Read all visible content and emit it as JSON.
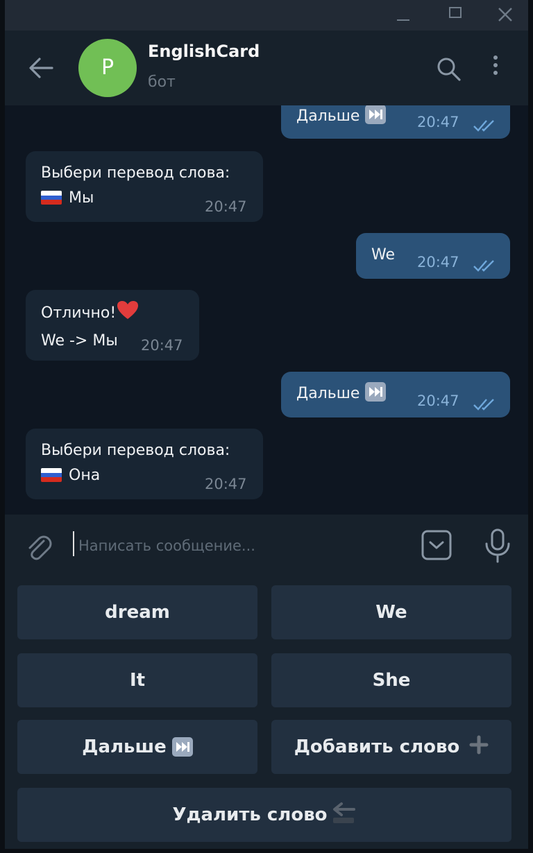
{
  "window": {
    "controls": [
      "minimize-icon",
      "maximize-icon",
      "close-icon"
    ]
  },
  "header": {
    "avatar_letter": "P",
    "avatar_color": "#71bf55",
    "title": "EnglishCard",
    "subtitle": "бот"
  },
  "messages": [
    {
      "dir": "out",
      "text": "Дальше",
      "icon": "fast-forward-icon",
      "time": "20:47",
      "status": "read"
    },
    {
      "dir": "in",
      "line1": "Выбери перевод слова:",
      "line2": "Мы",
      "flag": "russia-flag-icon",
      "time": "20:47"
    },
    {
      "dir": "out",
      "text": "We",
      "time": "20:47",
      "status": "read"
    },
    {
      "dir": "in",
      "line1": "Отлично!",
      "line2": "We -> Мы",
      "icon": "heart-icon",
      "time": "20:47"
    },
    {
      "dir": "out",
      "text": "Дальше",
      "icon": "fast-forward-icon",
      "time": "20:47",
      "status": "read"
    },
    {
      "dir": "in",
      "line1": "Выбери перевод слова:",
      "line2": "Она",
      "flag": "russia-flag-icon",
      "time": "20:47"
    }
  ],
  "composer": {
    "placeholder": "Написать сообщение..."
  },
  "keyboard": {
    "buttons": [
      "dream",
      "We",
      "It",
      "She",
      "Дальше",
      "Добавить слово",
      "Удалить слово"
    ]
  },
  "colors": {
    "incoming": "#182533",
    "outgoing": "#2b5278",
    "background": "#0e1621",
    "panel": "#17212b"
  }
}
